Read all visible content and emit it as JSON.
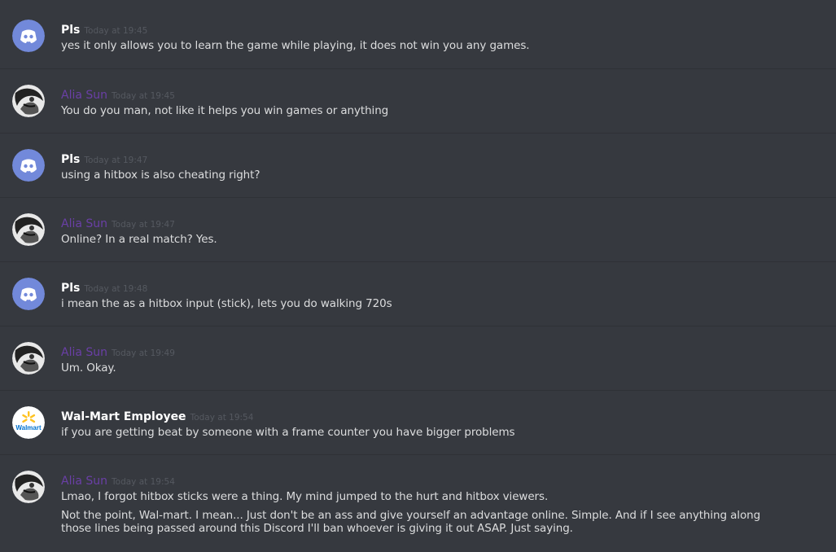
{
  "messages": [
    {
      "author": "Pls",
      "author_color": "#ffffff",
      "avatar": "discord-default-avatar-icon",
      "time": "Today at 19:45",
      "lines": [
        "yes it only allows you to learn the game while  playing, it does not win you any games."
      ]
    },
    {
      "author": "Alia Sun",
      "author_color": "#6a3fa6",
      "avatar": "alia-sun-avatar-icon",
      "time": "Today at 19:45",
      "lines": [
        "You do you man, not like it helps you win games or anything"
      ]
    },
    {
      "author": "Pls",
      "author_color": "#ffffff",
      "avatar": "discord-default-avatar-icon",
      "time": "Today at 19:47",
      "lines": [
        "using a hitbox is also cheating right?"
      ]
    },
    {
      "author": "Alia Sun",
      "author_color": "#6a3fa6",
      "avatar": "alia-sun-avatar-icon",
      "time": "Today at 19:47",
      "lines": [
        "Online? In a real match? Yes."
      ]
    },
    {
      "author": "Pls",
      "author_color": "#ffffff",
      "avatar": "discord-default-avatar-icon",
      "time": "Today at 19:48",
      "lines": [
        "i mean the as a hitbox input (stick), lets you do walking 720s"
      ]
    },
    {
      "author": "Alia Sun",
      "author_color": "#6a3fa6",
      "avatar": "alia-sun-avatar-icon",
      "time": "Today at 19:49",
      "lines": [
        "Um. Okay."
      ]
    },
    {
      "author": "Wal-Mart Employee",
      "author_color": "#ffffff",
      "avatar": "walmart-logo-avatar-icon",
      "avatar_logo_text": "Walmart",
      "time": "Today at 19:54",
      "lines": [
        "if you are getting beat by someone with a frame counter you have bigger problems"
      ]
    },
    {
      "author": "Alia Sun",
      "author_color": "#6a3fa6",
      "avatar": "alia-sun-avatar-icon",
      "time": "Today at 19:54",
      "lines": [
        "Lmao, I forgot hitbox sticks were a thing. My mind jumped to the hurt and hitbox viewers.",
        "Not the point, Wal-mart. I mean... Just don't be an ass and give yourself an advantage online. Simple. And if I see anything along those lines being passed around this Discord I'll ban whoever is giving it out ASAP. Just saying."
      ]
    }
  ],
  "colors": {
    "background": "#36393f",
    "blurple": "#7289da",
    "walmart_yellow": "#ffc220",
    "walmart_blue": "#0071ce"
  }
}
